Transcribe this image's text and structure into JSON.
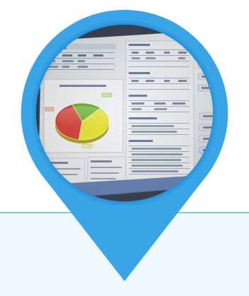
{
  "photo": {
    "subject": "projected-monitoring-software-screen",
    "colors": {
      "pin_blue": "#3aa5e6",
      "pin_ring": "#2996de",
      "screen_bg": "#e9ecee",
      "band": "#eef8fe",
      "pie_green": "#6fb62f",
      "pie_yellow": "#e8e63a",
      "pie_red": "#d9473e"
    },
    "chart": {
      "type": "pie",
      "values": [
        0.18,
        0.4,
        0.42
      ]
    }
  }
}
